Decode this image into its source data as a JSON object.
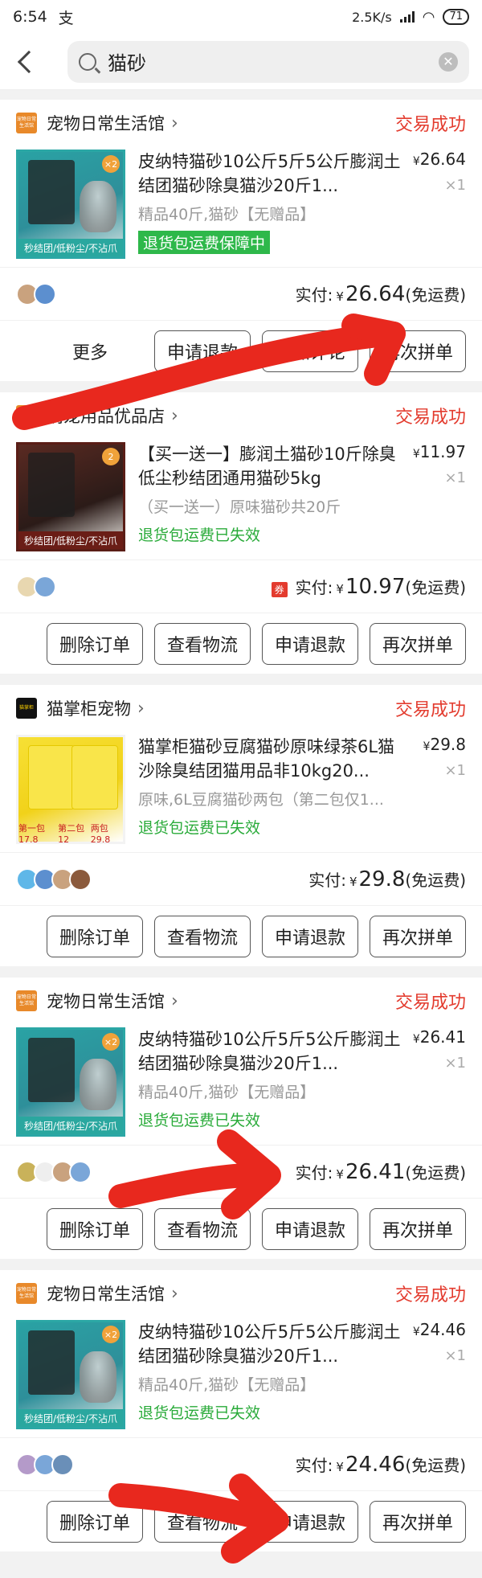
{
  "status_bar": {
    "time": "6:54",
    "app_glyph": "支",
    "net_speed": "2.5K/s",
    "battery": "71"
  },
  "search": {
    "query": "猫砂"
  },
  "orders": [
    {
      "shop_logo": "宠物日常生活馆",
      "shop": "宠物日常生活馆",
      "status": "交易成功",
      "thumb_label": "秒结团/低粉尘/不沾爪",
      "thumb_badge": "×2",
      "title": "皮纳特猫砂10公斤5斤5公斤膨润土结团猫砂除臭猫沙20斤1...",
      "spec": "精品40斤,猫砂【无赠品】",
      "guarantee": "退货包运费保障中",
      "price": "26.64",
      "qty": "×1",
      "paid_label": "实付:",
      "paid_amount": "26.64",
      "shipping": "(免运费)",
      "more": "更多",
      "buttons": [
        "申请退款",
        "追加评论",
        "再次拼单"
      ]
    },
    {
      "shop_logo": "萌宠用品优品店",
      "shop": "萌宠用品优品店",
      "status": "交易成功",
      "thumb_label": "秒结团/低粉尘/不沾爪",
      "thumb_badge": "2",
      "title": "【买一送一】膨润土猫砂10斤除臭低尘秒结团通用猫砂5kg",
      "spec": "（买一送一）原味猫砂共20斤",
      "guarantee": "退货包运费已失效",
      "price": "11.97",
      "qty": "×1",
      "coupon": "券",
      "paid_label": "实付:",
      "paid_amount": "10.97",
      "shipping": "(免运费)",
      "buttons": [
        "删除订单",
        "查看物流",
        "申请退款",
        "再次拼单"
      ]
    },
    {
      "shop_logo": "猫掌柜",
      "shop": "猫掌柜宠物",
      "status": "交易成功",
      "thumb_label_a": "第一包 17.8",
      "thumb_label_b": "第二包 12",
      "thumb_label_c": "两包 29.8",
      "title": "猫掌柜猫砂豆腐猫砂原味绿茶6L猫沙除臭结团猫用品非10kg20...",
      "spec": "原味,6L豆腐猫砂两包（第二包仅1...",
      "guarantee": "退货包运费已失效",
      "price": "29.8",
      "qty": "×1",
      "paid_label": "实付:",
      "paid_amount": "29.8",
      "shipping": "(免运费)",
      "buttons": [
        "删除订单",
        "查看物流",
        "申请退款",
        "再次拼单"
      ]
    },
    {
      "shop_logo": "宠物日常生活馆",
      "shop": "宠物日常生活馆",
      "status": "交易成功",
      "thumb_label": "秒结团/低粉尘/不沾爪",
      "thumb_badge": "×2",
      "title": "皮纳特猫砂10公斤5斤5公斤膨润土结团猫砂除臭猫沙20斤1...",
      "spec": "精品40斤,猫砂【无赠品】",
      "guarantee": "退货包运费已失效",
      "price": "26.41",
      "qty": "×1",
      "paid_label": "实付:",
      "paid_amount": "26.41",
      "shipping": "(免运费)",
      "buttons": [
        "删除订单",
        "查看物流",
        "申请退款",
        "再次拼单"
      ]
    },
    {
      "shop_logo": "宠物日常生活馆",
      "shop": "宠物日常生活馆",
      "status": "交易成功",
      "thumb_label": "秒结团/低粉尘/不沾爪",
      "thumb_badge": "×2",
      "title": "皮纳特猫砂10公斤5斤5公斤膨润土结团猫砂除臭猫沙20斤1...",
      "spec": "精品40斤,猫砂【无赠品】",
      "guarantee": "退货包运费已失效",
      "price": "24.46",
      "qty": "×1",
      "paid_label": "实付:",
      "paid_amount": "24.46",
      "shipping": "(免运费)",
      "buttons": [
        "删除订单",
        "查看物流",
        "申请退款",
        "再次拼单"
      ]
    }
  ],
  "currency_symbol": "¥",
  "colors": {
    "status_red": "#e33b2e",
    "guarantee_green": "#2aab3a",
    "annotation_red": "#e8281e"
  }
}
